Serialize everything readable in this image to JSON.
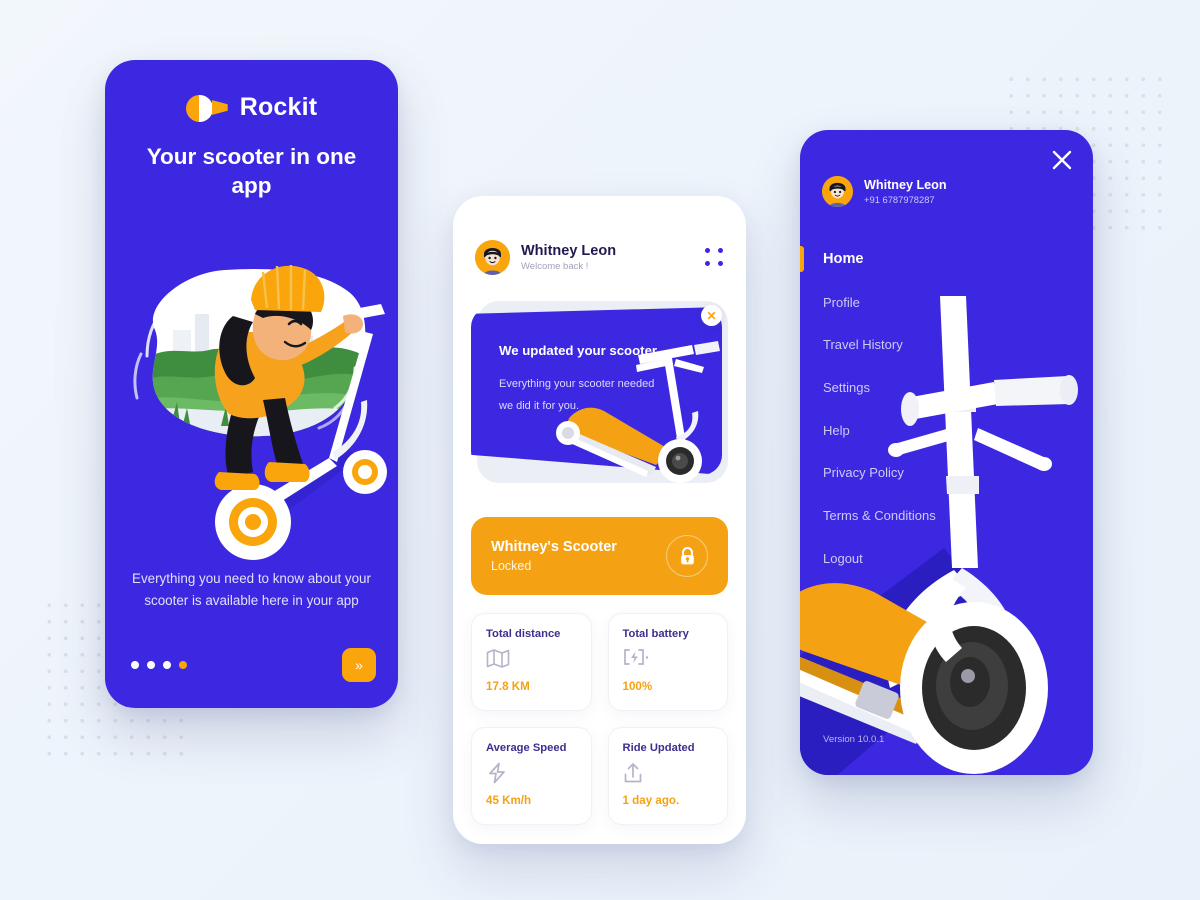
{
  "colors": {
    "brand_blue": "#3b28e0",
    "brand_orange": "#f9a50b",
    "accent_orange": "#f4a214",
    "page_background": "#eef4fb",
    "dot_pattern": "#d6dde6",
    "dark_navy": "#211a52"
  },
  "onboarding": {
    "brand_name": "Rockit",
    "logo_icon": "rockit-logo-icon",
    "headline": "Your scooter in one app",
    "subcopy": "Everything you need to know about your scooter is available here in your app",
    "pagination": {
      "total": 4,
      "active_index": 3
    },
    "next_button_label": "»",
    "illustration": "woman-riding-scooter-illustration"
  },
  "dashboard": {
    "user": {
      "name": "Whitney Leon",
      "greeting": "Welcome back !",
      "avatar": "user-avatar"
    },
    "menu_icon": "grid-menu-icon",
    "promo": {
      "title": "We updated your scooter",
      "body": "Everything your scooter needed we did it for you.",
      "close_label": "✕",
      "illustration": "electric-scooter-illustration"
    },
    "scooter_bar": {
      "title": "Whitney's Scooter",
      "status": "Locked",
      "lock_icon": "lock-icon"
    },
    "stats": [
      {
        "label": "Total distance",
        "value": "17.8 KM",
        "icon": "map-icon"
      },
      {
        "label": "Total battery",
        "value": "100%",
        "icon": "battery-charging-icon"
      },
      {
        "label": "Average Speed",
        "value": "45 Km/h",
        "icon": "lightning-bolt-icon"
      },
      {
        "label": "Ride Updated",
        "value": "1 day ago.",
        "icon": "upload-icon"
      }
    ]
  },
  "menu": {
    "close_icon": "close-icon",
    "user": {
      "name": "Whitney Leon",
      "phone": "+91 6787978287",
      "avatar": "user-avatar"
    },
    "items": [
      {
        "label": "Home",
        "active": true
      },
      {
        "label": "Profile",
        "active": false
      },
      {
        "label": "Travel History",
        "active": false
      },
      {
        "label": "Settings",
        "active": false
      },
      {
        "label": "Help",
        "active": false
      },
      {
        "label": "Privacy Policy",
        "active": false
      },
      {
        "label": "Terms & Conditions",
        "active": false
      },
      {
        "label": "Logout",
        "active": false
      }
    ],
    "version": "Version 10.0.1",
    "illustration": "electric-scooter-illustration"
  }
}
